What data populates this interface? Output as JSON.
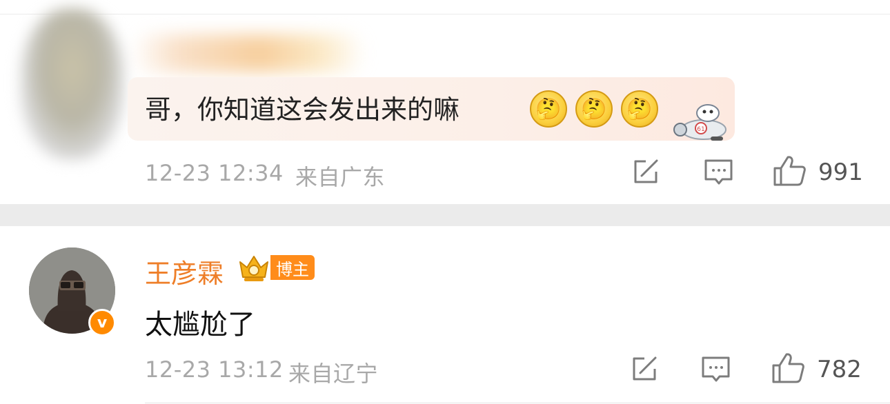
{
  "comment1": {
    "text": "哥，你知道这会发出来的嘛",
    "emoji_count": 3,
    "emoji_name": "thinking-face-emoji",
    "timestamp": "12-23 12:34",
    "location": "来自广东",
    "like_count": "991"
  },
  "comment2": {
    "username": "王彦霖",
    "badge": "博主",
    "text": "太尴尬了",
    "timestamp": "12-23 13:12",
    "location": "来自辽宁",
    "like_count": "782"
  },
  "colors": {
    "username": "#ee7e28",
    "badge_bg": "#ff8c1a",
    "verify_bg": "#ff8a00",
    "meta_text": "#a8a8a8",
    "divider": "#ebebeb"
  },
  "icons": [
    "repost-icon",
    "comment-icon",
    "like-icon",
    "verified-icon",
    "crown-icon"
  ]
}
